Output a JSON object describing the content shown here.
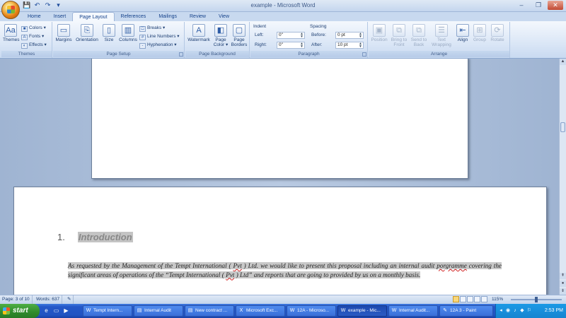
{
  "window": {
    "title": "example - Microsoft Word",
    "minimize": "–",
    "restore": "❐",
    "close": "✕"
  },
  "qat": {
    "save_icon": "💾",
    "undo_icon": "↶",
    "redo_icon": "↷",
    "customize_icon": "▾"
  },
  "tabs": [
    "Home",
    "Insert",
    "Page Layout",
    "References",
    "Mailings",
    "Review",
    "View"
  ],
  "active_tab": "Page Layout",
  "ribbon": {
    "themes": {
      "label": "Themes",
      "themes_btn": "Themes",
      "colors": "Colors ▾",
      "fonts": "Fonts ▾",
      "effects": "Effects ▾"
    },
    "page_setup": {
      "label": "Page Setup",
      "margins": "Margins",
      "orientation": "Orientation",
      "size": "Size",
      "columns": "Columns",
      "breaks": "Breaks ▾",
      "line_numbers": "Line Numbers ▾",
      "hyphenation": "Hyphenation ▾"
    },
    "page_background": {
      "label": "Page Background",
      "watermark": "Watermark",
      "page_color": "Page Color ▾",
      "page_borders": "Page Borders"
    },
    "paragraph": {
      "label": "Paragraph",
      "indent": "Indent",
      "left_label": "Left:",
      "left_value": "0\"",
      "right_label": "Right:",
      "right_value": "0\"",
      "spacing": "Spacing",
      "before_label": "Before:",
      "before_value": "0 pt",
      "after_label": "After:",
      "after_value": "10 pt"
    },
    "arrange": {
      "label": "Arrange",
      "position": "Position",
      "bring_to_front": "Bring to Front",
      "send_to_back": "Send to Back",
      "text_wrapping": "Text Wrapping",
      "align": "Align",
      "group": "Group",
      "rotate": "Rotate"
    }
  },
  "document": {
    "heading_number": "1.",
    "heading_text": "Introduction",
    "paragraph_parts": [
      "As requested by the Management of the Tempt International ( ",
      "Pvt",
      " ) Ltd. we would like to present this proposal including an internal audit ",
      "porgramme",
      " covering the significant areas of operations of the “Tempt International ( ",
      "Pvt",
      " ) Ltd” and reports that are going to provided by us on a monthly basis."
    ]
  },
  "statusbar": {
    "page": "Page: 3 of 10",
    "words": "Words: 637",
    "zoom": "115%"
  },
  "taskbar": {
    "start": "start",
    "tasks": [
      "Tempt Intern...",
      "Internal Audit",
      "New contract ...",
      "Microsoft Exc...",
      "12A - Microso...",
      "example - Mic...",
      "Internal Audit...",
      "12A 3 - Paint"
    ],
    "active_task": "example - Mic...",
    "clock": "2:53 PM"
  }
}
